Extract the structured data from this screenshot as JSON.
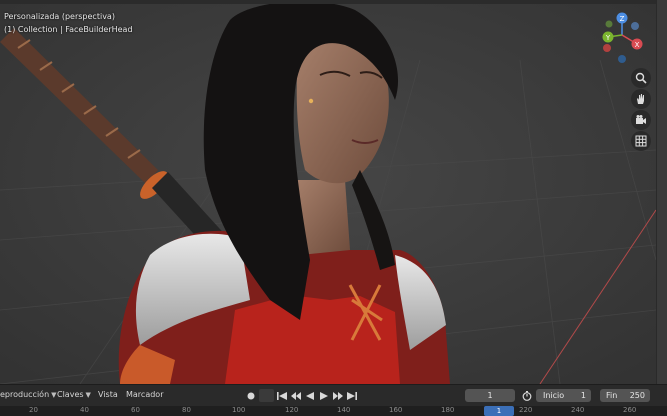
{
  "viewport": {
    "mode_label": "Personalizada (perspectiva)",
    "object_label": "(1) Collection | FaceBuilderHead"
  },
  "gizmo": {
    "z": "Z",
    "y": "Y",
    "x": "X"
  },
  "nav_icons": [
    "zoom-icon",
    "hand-pan-icon",
    "camera-icon",
    "grid-icon"
  ],
  "timeline": {
    "playback_label": "eproducción",
    "keys_label": "Claves",
    "view_label": "Vista",
    "marker_label": "Marcador",
    "current_frame": "1",
    "start_label": "Inicio",
    "start_value": "1",
    "end_label": "Fin",
    "end_value": "250"
  },
  "ruler": {
    "ticks": [
      "20",
      "40",
      "60",
      "80",
      "100",
      "120",
      "140",
      "160",
      "180",
      "200",
      "220",
      "240",
      "260"
    ],
    "playhead_label": "1"
  },
  "colors": {
    "accent": "#3b6fb8",
    "axis_x": "#d94b52",
    "axis_y": "#7bb52e",
    "axis_z": "#4d8ee3"
  }
}
